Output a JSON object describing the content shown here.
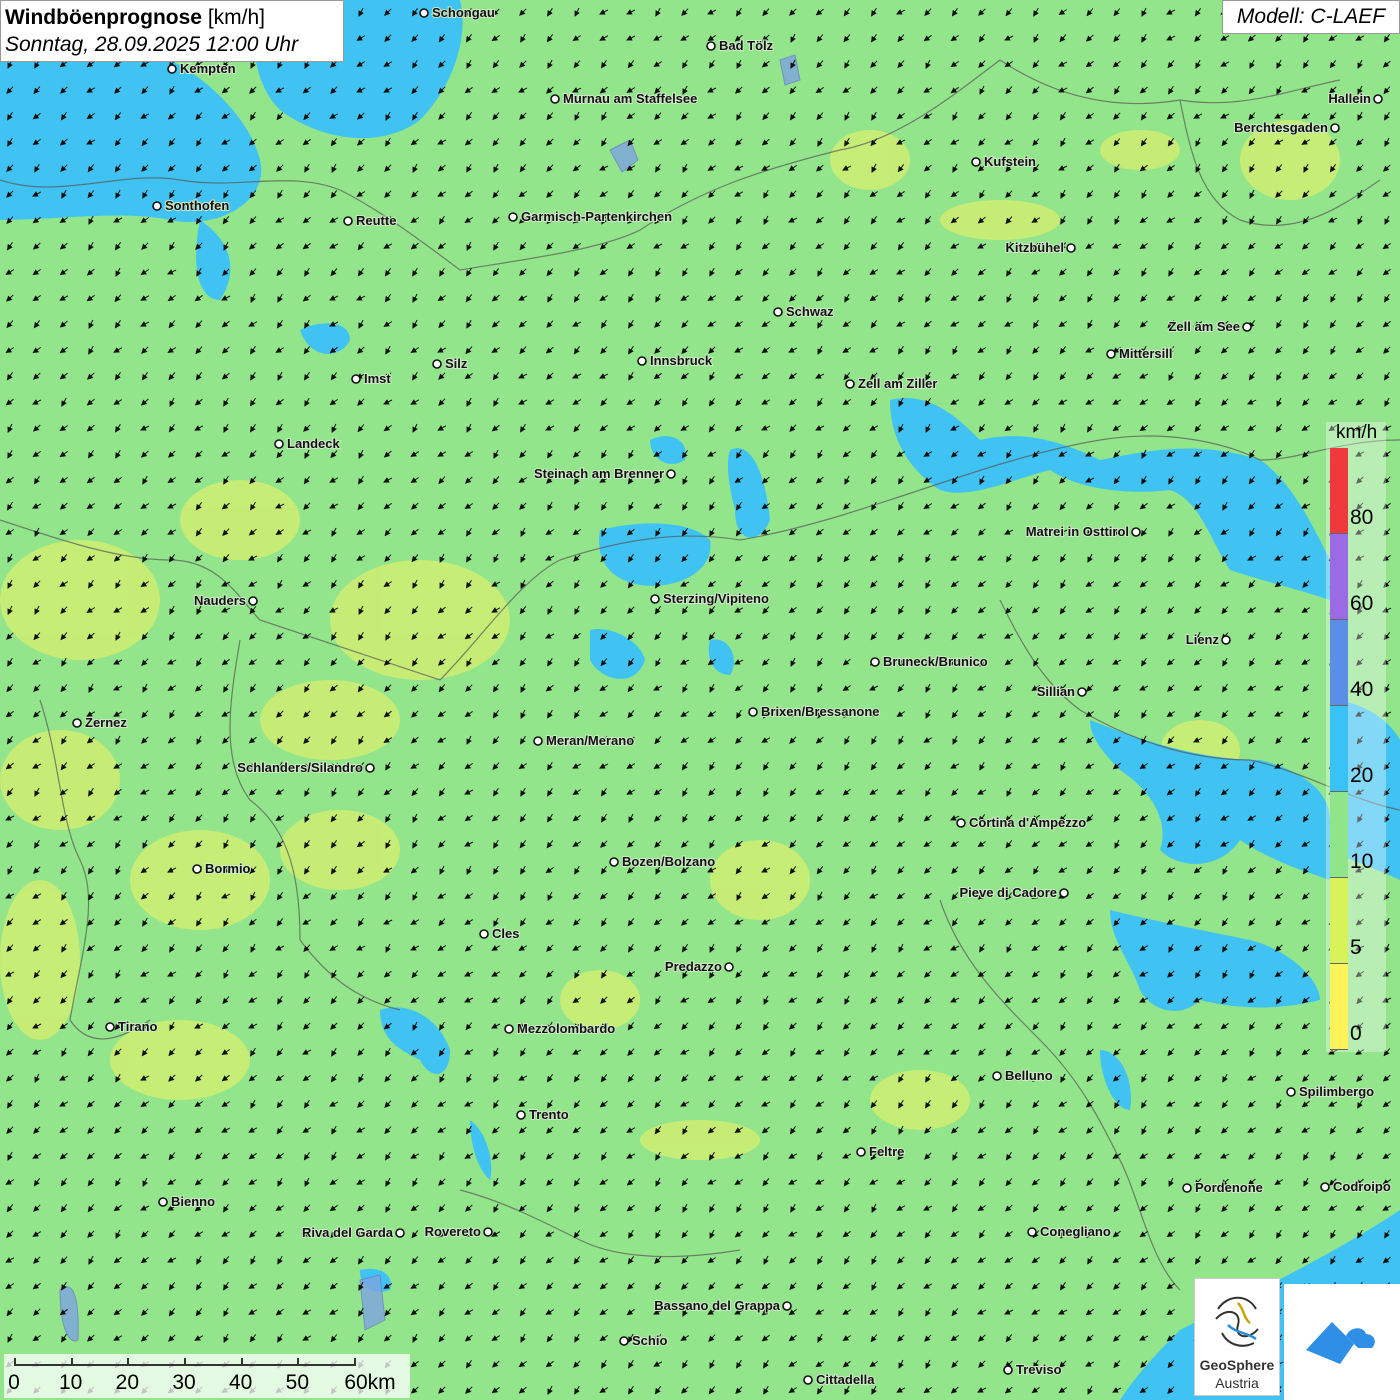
{
  "header": {
    "title_bold": "Windböenprognose",
    "title_unit": "[km/h]",
    "datetime": "Sonntag, 28.09.2025 12:00 Uhr"
  },
  "model": "Modell: C-LAEF",
  "legend": {
    "unit": "km/h",
    "ticks": [
      "80",
      "60",
      "40",
      "20",
      "10",
      "5",
      "0"
    ],
    "colors": [
      "#f0393c",
      "#9b6be6",
      "#5a8fe6",
      "#39c2f5",
      "#90e58a",
      "#d8f25a",
      "#fff35a"
    ]
  },
  "scale_bar": {
    "labels": [
      "0",
      "10",
      "20",
      "30",
      "40",
      "50",
      "60km"
    ]
  },
  "logos": {
    "geosphere_line1": "GeoSphere",
    "geosphere_line2": "Austria"
  },
  "wind_direction": "from northeast",
  "cities": [
    {
      "name": "Schongau"
    },
    {
      "name": "Bad Tölz"
    },
    {
      "name": "Kempten"
    },
    {
      "name": "Murnau am Staffelsee"
    },
    {
      "name": "Hallein"
    },
    {
      "name": "Berchtesgaden"
    },
    {
      "name": "Kufstein"
    },
    {
      "name": "Sonthofen"
    },
    {
      "name": "Reutte"
    },
    {
      "name": "Garmisch-Partenkirchen"
    },
    {
      "name": "Kitzbühel"
    },
    {
      "name": "Schwaz"
    },
    {
      "name": "Zell am See"
    },
    {
      "name": "Innsbruck"
    },
    {
      "name": "Silz"
    },
    {
      "name": "Mittersill"
    },
    {
      "name": "Imst"
    },
    {
      "name": "Zell am Ziller"
    },
    {
      "name": "Landeck"
    },
    {
      "name": "Steinach am Brenner"
    },
    {
      "name": "Matrei in Osttirol"
    },
    {
      "name": "Nauders"
    },
    {
      "name": "Sterzing/Vipiteno"
    },
    {
      "name": "Lienz"
    },
    {
      "name": "Bruneck/Brunico"
    },
    {
      "name": "Sillian"
    },
    {
      "name": "Brixen/Bressanone"
    },
    {
      "name": "Zernez"
    },
    {
      "name": "Meran/Merano"
    },
    {
      "name": "Schlanders/Silandro"
    },
    {
      "name": "Cortina d'Ampezzo"
    },
    {
      "name": "Bozen/Bolzano"
    },
    {
      "name": "Bormio"
    },
    {
      "name": "Pieve di Cadore"
    },
    {
      "name": "Cles"
    },
    {
      "name": "Predazzo"
    },
    {
      "name": "Tirano"
    },
    {
      "name": "Mezzolombardo"
    },
    {
      "name": "Belluno"
    },
    {
      "name": "Spilimbergo"
    },
    {
      "name": "Trento"
    },
    {
      "name": "Feltre"
    },
    {
      "name": "Pordenone"
    },
    {
      "name": "Codroipo"
    },
    {
      "name": "Bienno"
    },
    {
      "name": "Riva del Garda"
    },
    {
      "name": "Rovereto"
    },
    {
      "name": "Conegliano"
    },
    {
      "name": "Bassano del Grappa"
    },
    {
      "name": "Schio"
    },
    {
      "name": "Treviso"
    },
    {
      "name": "Cittadella"
    }
  ]
}
